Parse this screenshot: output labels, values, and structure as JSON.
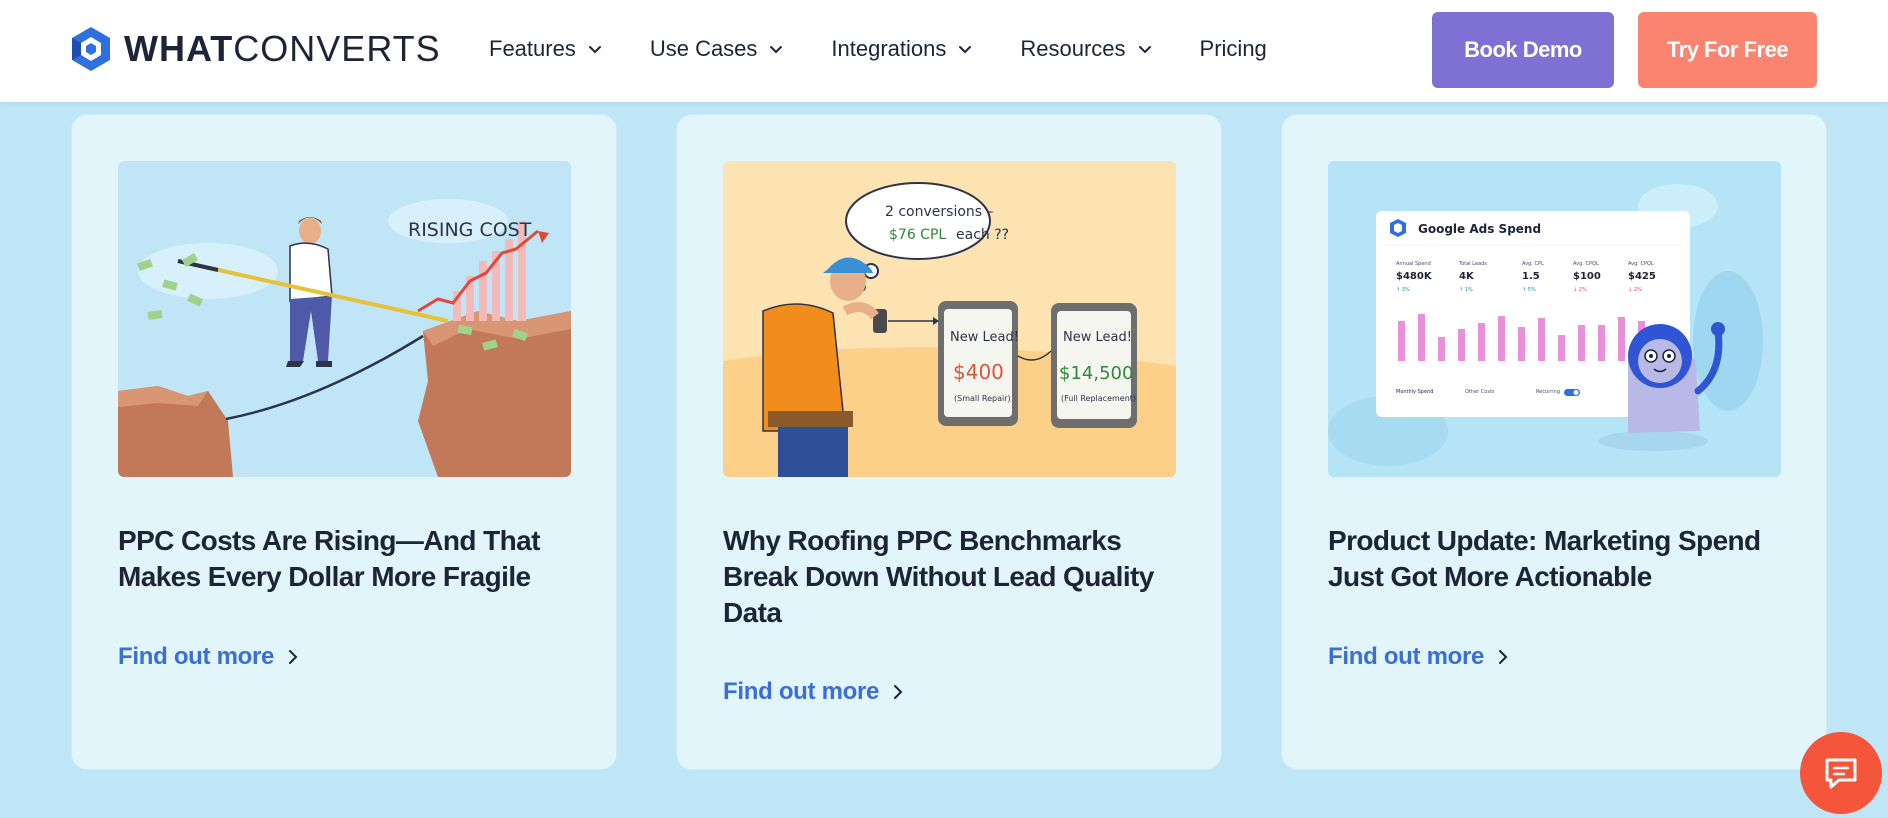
{
  "header": {
    "logo": {
      "part1": "WHAT",
      "part2": "CONVERTS"
    },
    "nav": [
      {
        "label": "Features",
        "dropdown": true
      },
      {
        "label": "Use Cases",
        "dropdown": true
      },
      {
        "label": "Integrations",
        "dropdown": true
      },
      {
        "label": "Resources",
        "dropdown": true
      },
      {
        "label": "Pricing",
        "dropdown": false
      }
    ],
    "book_demo": "Book Demo",
    "try_free": "Try For Free"
  },
  "cards": [
    {
      "title": "PPC Costs Are Rising—And That Makes Every Dollar More Fragile",
      "link": "Find out more",
      "image_text": {
        "caption": "RISING COST"
      }
    },
    {
      "title": "Why Roofing PPC Benchmarks Break Down Without Lead Quality Data",
      "link": "Find out more",
      "image_text": {
        "bubble_line1": "2 conversions –",
        "bubble_cpl": "$76 CPL",
        "bubble_each": "each ??",
        "phone1_title": "New Lead!",
        "phone1_value": "$400",
        "phone1_note": "(Small Repair)",
        "phone2_title": "New Lead!",
        "phone2_value": "$14,500",
        "phone2_note": "(Full Replacement)"
      }
    },
    {
      "title": "Product Update: Marketing Spend Just Got More Actionable",
      "link": "Find out more",
      "image_text": {
        "panel_title": "Google Ads Spend",
        "stats": [
          {
            "label": "Annual Spend",
            "value": "$480K",
            "badge": "↑ 3%"
          },
          {
            "label": "Total Leads",
            "value": "4K",
            "badge": "↑ 1%"
          },
          {
            "label": "Avg. CPL",
            "value": "1.5",
            "badge": "↑ 5%"
          },
          {
            "label": "Avg. CPQL",
            "value": "$100",
            "badge": "↓ 2%"
          },
          {
            "label": "Avg. CPQL",
            "value": "$425",
            "badge": "↓ 2%"
          }
        ],
        "legend_1": "Monthly Spend",
        "legend_2": "Other Costs",
        "legend_3": "Recurring"
      }
    }
  ],
  "colors": {
    "page_bg": "#bfe6f7",
    "card_bg": "#e2f5fb",
    "demo_btn": "#7f70d4",
    "try_btn": "#fb8470",
    "link": "#3a6fd8",
    "chat": "#f5553a"
  },
  "icons": {
    "logo": "whatconverts-hex-icon",
    "nav_chevron": "chevron-down-icon",
    "link_chevron": "chevron-right-icon",
    "chat": "chat-bubble-icon"
  }
}
